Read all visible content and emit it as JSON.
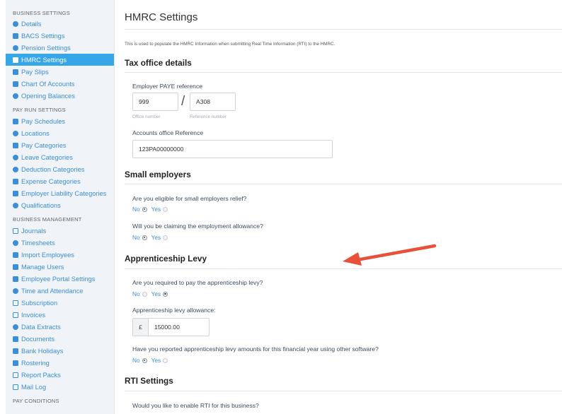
{
  "sidebar": {
    "business_settings_title": "BUSINESS SETTINGS",
    "business_settings": [
      "Details",
      "BACS Settings",
      "Pension Settings",
      "HMRC Settings",
      "Pay Slips",
      "Chart Of Accounts",
      "Opening Balances"
    ],
    "pay_run_settings_title": "PAY RUN SETTINGS",
    "pay_run_settings": [
      "Pay Schedules",
      "Locations",
      "Pay Categories",
      "Leave Categories",
      "Deduction Categories",
      "Expense Categories",
      "Employer Liability Categories",
      "Qualifications"
    ],
    "business_management_title": "BUSINESS MANAGEMENT",
    "business_management": [
      "Journals",
      "Timesheets",
      "Import Employees",
      "Manage Users",
      "Employee Portal Settings",
      "Time and Attendance",
      "Subscription",
      "Invoices",
      "Data Extracts",
      "Documents",
      "Bank Holidays",
      "Rostering",
      "Report Packs",
      "Mail Log"
    ],
    "pay_conditions_title": "PAY CONDITIONS",
    "accent_color": "#36a6e8"
  },
  "main": {
    "title": "HMRC Settings",
    "intro": "This is used to populate the HMRC Information when submitting Real Time Information (RTI) to the HMRC.",
    "tax_office": {
      "heading": "Tax office details",
      "paye_label": "Employer PAYE reference",
      "office_number": "999",
      "reference_number": "A308",
      "separator": "/",
      "office_number_hint": "Office number",
      "reference_number_hint": "Reference number",
      "accounts_office_label": "Accounts office Reference",
      "accounts_office_value": "123PA00000000"
    },
    "small_employers": {
      "heading": "Small employers",
      "q1": "Are you eligible for small employers relief?",
      "q2": "Will you be claiming the employment allowance?"
    },
    "apprenticeship": {
      "heading": "Apprenticeship Levy",
      "q1": "Are you required to pay the apprenticeship levy?",
      "allowance_label": "Apprenticeship levy allowance:",
      "currency": "£",
      "allowance_value": "15000.00",
      "q2": "Have you reported apprenticeship levy amounts for this financial year using other software?"
    },
    "rti": {
      "heading": "RTI Settings",
      "q1": "Would you like to enable RTI for this business?"
    },
    "no_label": "No",
    "yes_label": "Yes"
  }
}
